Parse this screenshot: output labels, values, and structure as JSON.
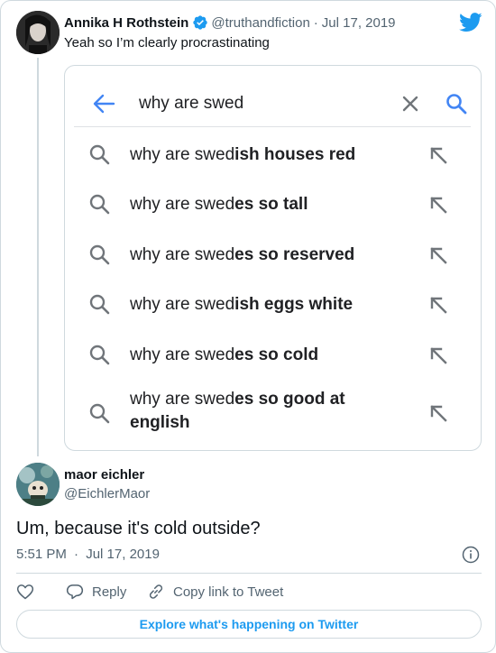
{
  "tweet": {
    "author_name": "Annika H Rothstein",
    "author_handle": "@truthandfiction",
    "separator": "·",
    "date": "Jul 17, 2019",
    "text": "Yeah so I’m clearly procrastinating",
    "verified": true
  },
  "search_screenshot": {
    "query": "why are swed",
    "suggestions": [
      {
        "prefix": "why are swed",
        "completion": "ish houses red"
      },
      {
        "prefix": "why are swed",
        "completion": "es so tall"
      },
      {
        "prefix": "why are swed",
        "completion": "es so reserved"
      },
      {
        "prefix": "why are swed",
        "completion": "ish eggs white"
      },
      {
        "prefix": "why are swed",
        "completion": "es so cold"
      },
      {
        "prefix": "why are swed",
        "completion": "es so good at english"
      }
    ]
  },
  "reply": {
    "author_name": "maor eichler",
    "author_handle": "@EichlerMaor",
    "text": "Um, because it's cold outside?",
    "time": "5:51 PM",
    "separator": "·",
    "date": "Jul 17, 2019"
  },
  "actions": {
    "reply_label": "Reply",
    "copy_label": "Copy link to Tweet"
  },
  "explore_label": "Explore what's happening on Twitter",
  "colors": {
    "twitter_blue": "#1d9bf0",
    "google_blue": "#4285f4",
    "muted_text": "#536471",
    "border": "#cfd9de"
  },
  "icons": [
    "twitter-bird-icon",
    "verified-badge-icon",
    "back-arrow-icon",
    "clear-x-icon",
    "search-icon",
    "magnifier-icon",
    "arrow-up-left-icon",
    "info-icon",
    "heart-icon",
    "reply-icon",
    "link-icon"
  ]
}
